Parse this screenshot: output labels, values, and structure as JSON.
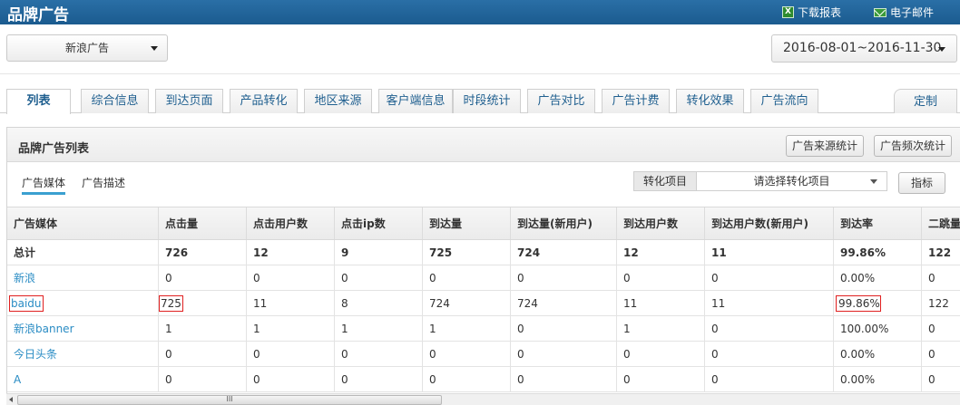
{
  "header": {
    "title": "品牌广告",
    "download_label": "下载报表",
    "email_label": "电子邮件",
    "download_icon": "excel-icon",
    "email_icon": "mail-icon"
  },
  "controls": {
    "media_select_value": "新浪广告",
    "date_range_value": "2016-08-01~2016-11-30"
  },
  "tabs": [
    {
      "label": "列表",
      "active": true
    },
    {
      "label": "综合信息"
    },
    {
      "label": "到达页面"
    },
    {
      "label": "产品转化"
    },
    {
      "label": "地区来源"
    },
    {
      "label": "客户端信息"
    },
    {
      "label": "时段统计"
    },
    {
      "label": "广告对比"
    },
    {
      "label": "广告计费"
    },
    {
      "label": "转化效果"
    },
    {
      "label": "广告流向"
    }
  ],
  "custom_tab_label": "定制",
  "panel": {
    "title": "品牌广告列表",
    "btn_source_stats": "广告来源统计",
    "btn_frequency_stats": "广告频次统计",
    "subtabs": [
      "广告媒体",
      "广告描述"
    ],
    "conversion_label": "转化项目",
    "conversion_select_value": "请选择转化项目",
    "metrics_button": "指标"
  },
  "table": {
    "columns": [
      "广告媒体",
      "点击量",
      "点击用户数",
      "点击ip数",
      "到达量",
      "到达量(新用户)",
      "到达用户数",
      "到达用户数(新用户)",
      "到达率",
      "二跳量"
    ],
    "rows": [
      [
        "总计",
        "726",
        "12",
        "9",
        "725",
        "724",
        "12",
        "11",
        "99.86%",
        "122"
      ],
      [
        "新浪",
        "0",
        "0",
        "0",
        "0",
        "0",
        "0",
        "0",
        "0.00%",
        "0"
      ],
      [
        "baidu",
        "725",
        "11",
        "8",
        "724",
        "724",
        "11",
        "11",
        "99.86%",
        "122"
      ],
      [
        "新浪banner",
        "1",
        "1",
        "1",
        "1",
        "0",
        "1",
        "0",
        "100.00%",
        "0"
      ],
      [
        "今日头条",
        "0",
        "0",
        "0",
        "0",
        "0",
        "0",
        "0",
        "0.00%",
        "0"
      ],
      [
        "A",
        "0",
        "0",
        "0",
        "0",
        "0",
        "0",
        "0",
        "0.00%",
        "0"
      ]
    ]
  },
  "scrollbar_grip": "III",
  "colors": {
    "header_bg": "#1f6499",
    "link": "#2a8cc4",
    "highlight_box": "#e02020"
  }
}
